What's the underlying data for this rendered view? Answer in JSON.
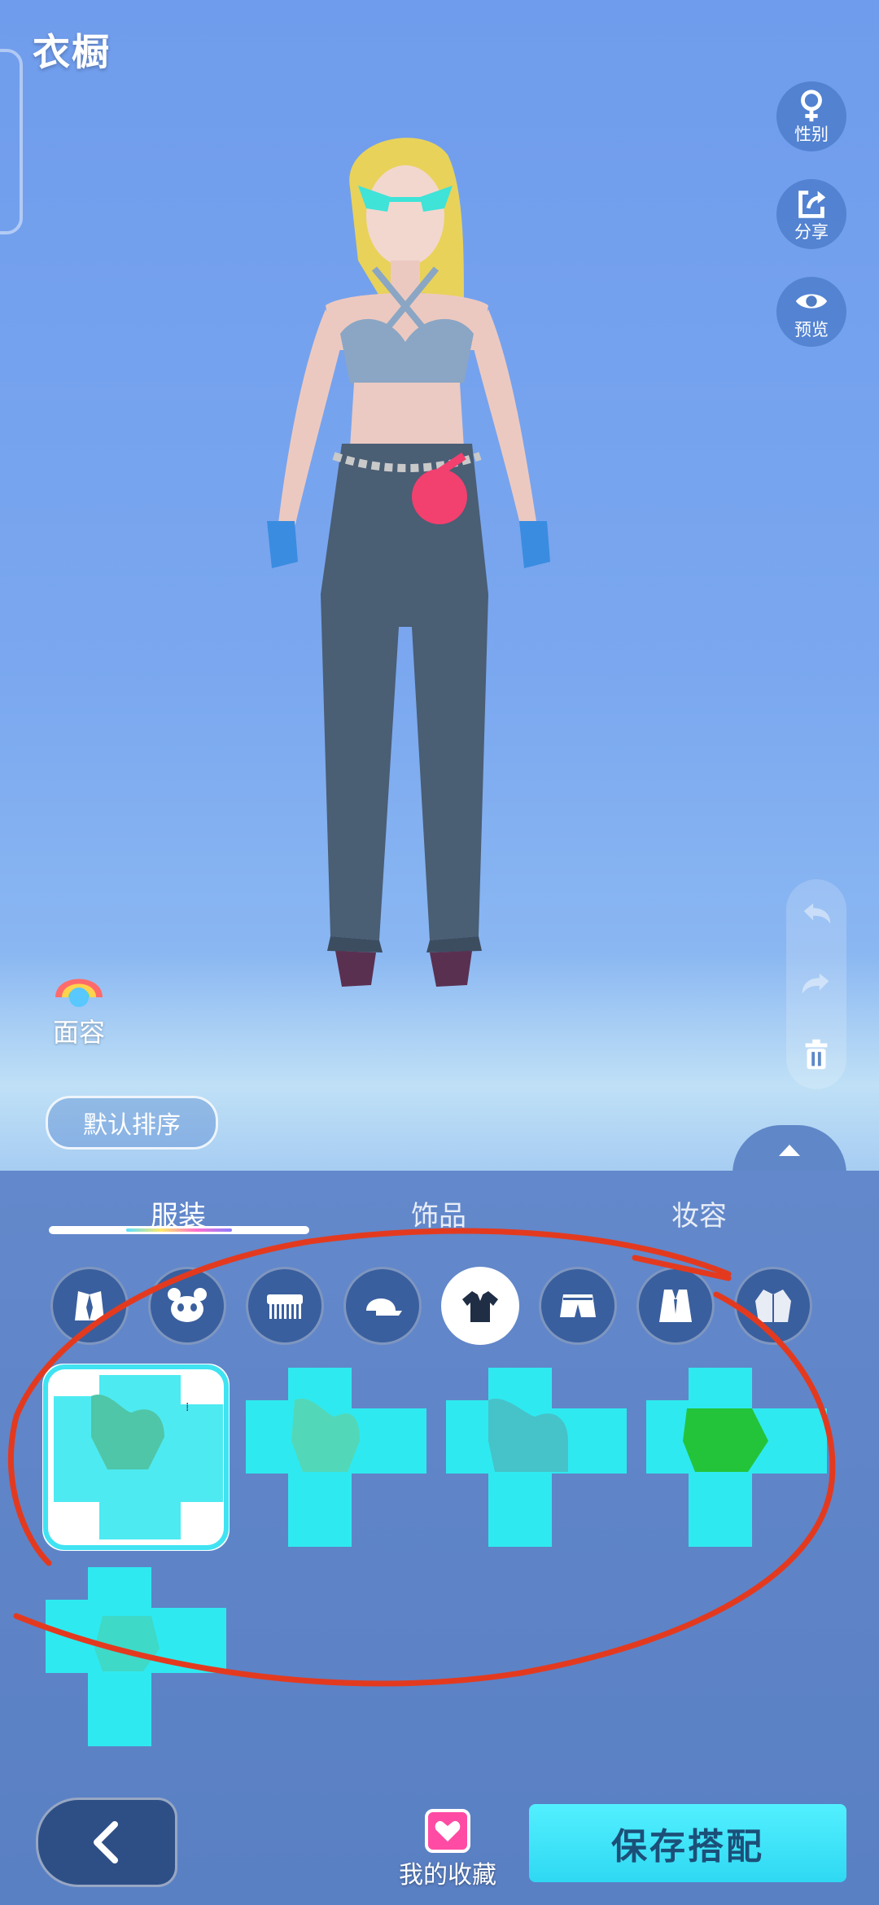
{
  "header": {
    "title": "衣橱"
  },
  "side_actions": [
    {
      "label": "性别",
      "icon": "female-gender-icon"
    },
    {
      "label": "分享",
      "icon": "share-icon"
    },
    {
      "label": "预览",
      "icon": "eye-icon"
    }
  ],
  "edit_actions": [
    "undo-icon",
    "redo-icon",
    "trash-icon"
  ],
  "face_button": {
    "label": "面容"
  },
  "sort_button": {
    "label": "默认排序"
  },
  "tabs": [
    {
      "label": "服装",
      "active": true
    },
    {
      "label": "饰品",
      "active": false
    },
    {
      "label": "妆容",
      "active": false
    }
  ],
  "categories": [
    {
      "icon": "suit-icon",
      "active": false
    },
    {
      "icon": "panda-icon",
      "active": false
    },
    {
      "icon": "comb-icon",
      "active": false
    },
    {
      "icon": "cap-icon",
      "active": false
    },
    {
      "icon": "shirt-icon",
      "active": true
    },
    {
      "icon": "shorts-icon",
      "active": false
    },
    {
      "icon": "vest-icon",
      "active": false
    },
    {
      "icon": "jacket-icon",
      "active": false
    }
  ],
  "items_count": 5,
  "selected_item": 1,
  "bottom": {
    "favorites_label": "我的收藏",
    "save_label": "保存搭配"
  },
  "colors": {
    "accent": "#2fd8f2",
    "panel": "#5a80c4",
    "annotation": "#e33a1f"
  }
}
